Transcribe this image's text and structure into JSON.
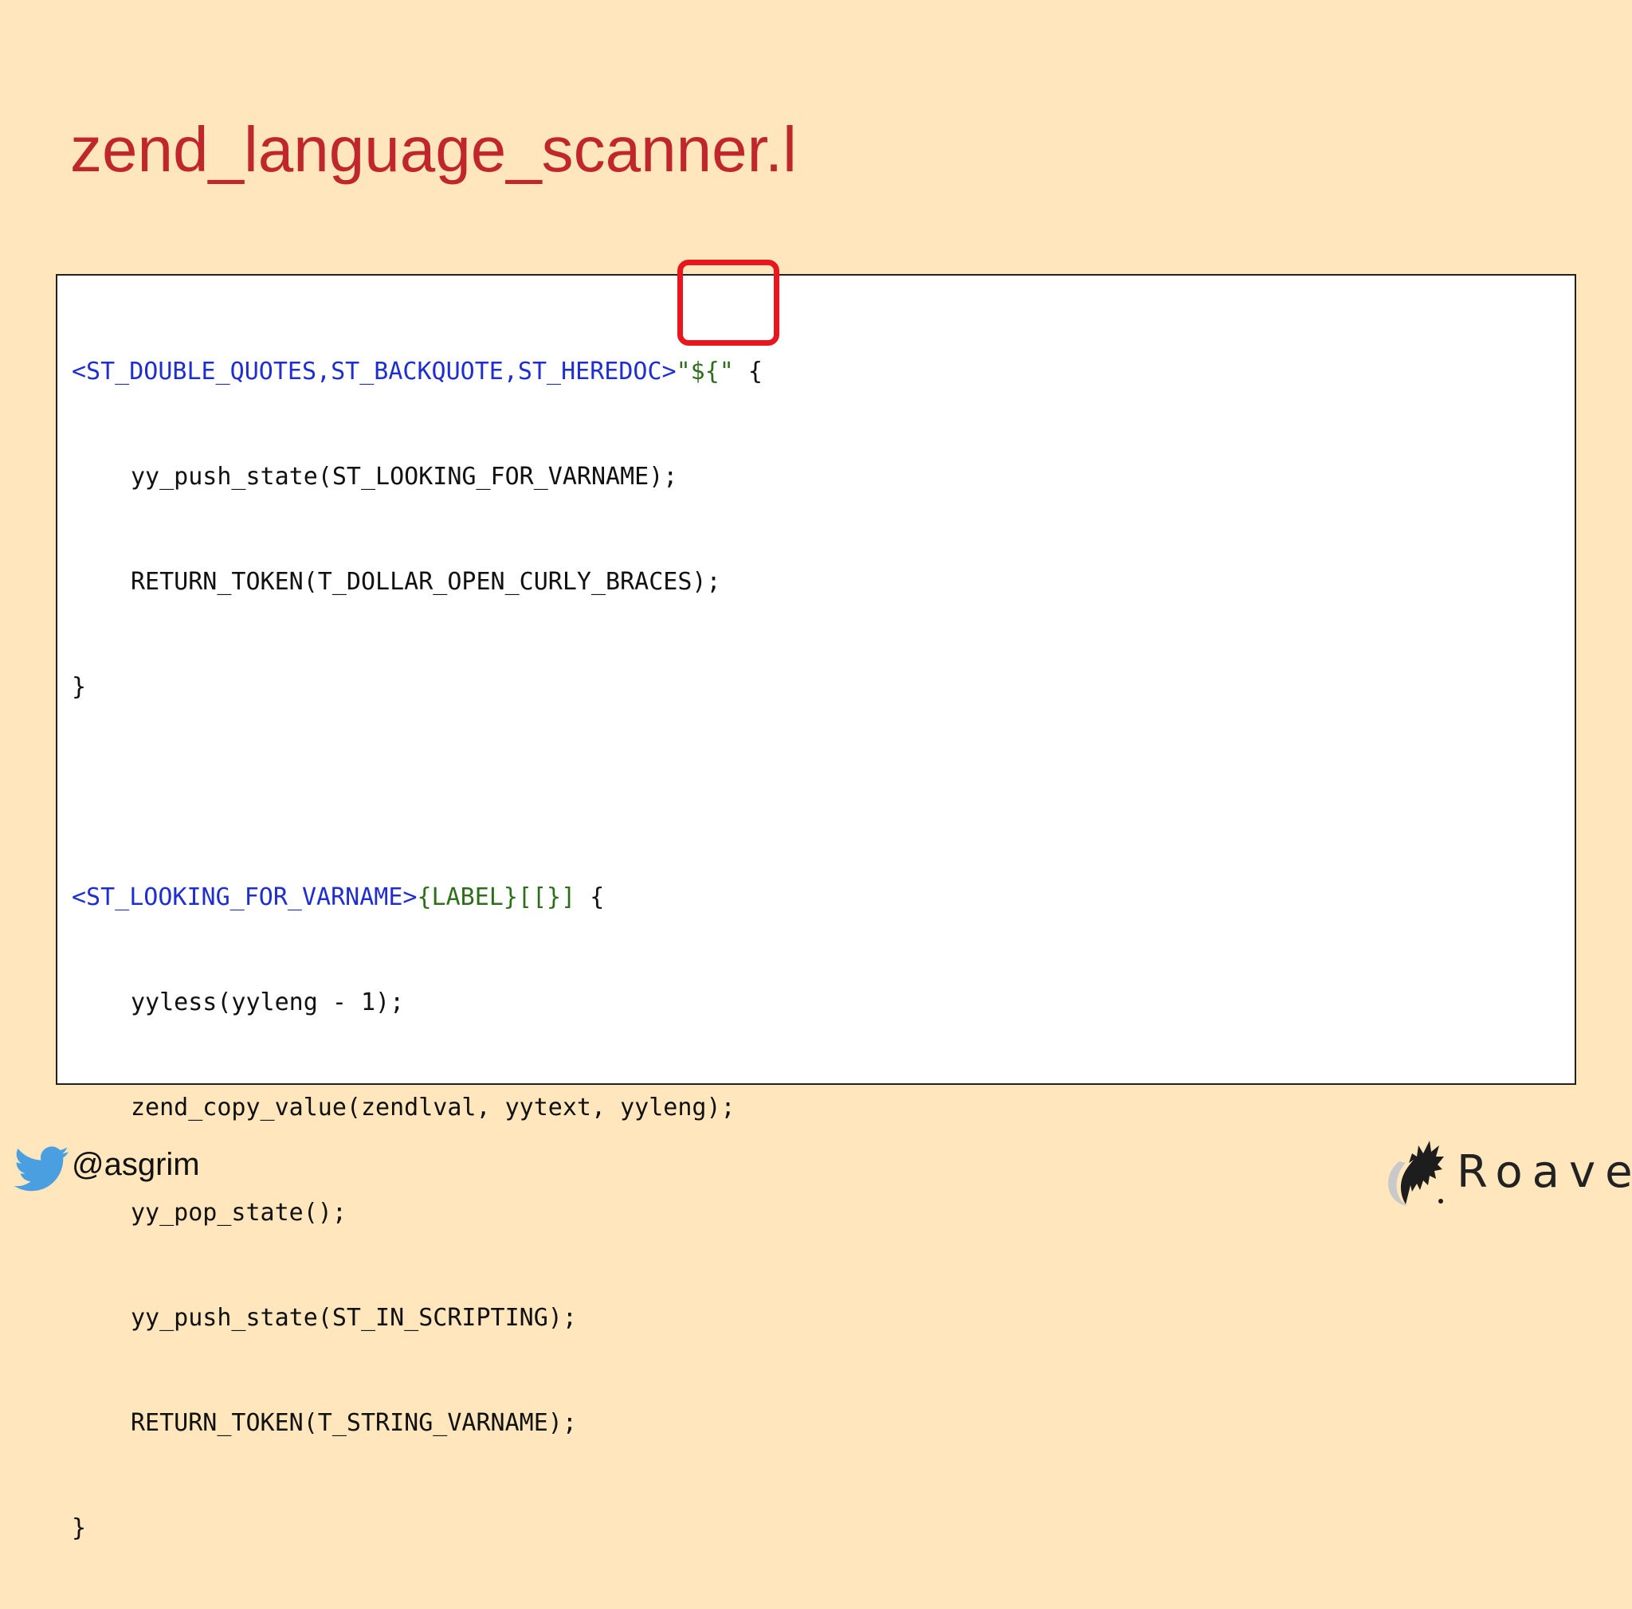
{
  "slide": {
    "title": "zend_language_scanner.l"
  },
  "code": {
    "lines": [
      {
        "state": "<ST_DOUBLE_QUOTES,ST_BACKQUOTE,ST_HEREDOC>",
        "pattern": "\"${\"",
        "tail": " {"
      },
      {
        "text": "yy_push_state(ST_LOOKING_FOR_VARNAME);"
      },
      {
        "text": "RETURN_TOKEN(T_DOLLAR_OPEN_CURLY_BRACES);"
      },
      {
        "text": "}"
      },
      {
        "text": ""
      },
      {
        "state": "<ST_LOOKING_FOR_VARNAME>",
        "pattern": "{LABEL}[[}]",
        "tail": " {"
      },
      {
        "text": "yyless(yyleng - 1);"
      },
      {
        "text": "zend_copy_value(zendlval, yytext, yyleng);"
      },
      {
        "text": "yy_pop_state();"
      },
      {
        "text": "yy_push_state(ST_IN_SCRIPTING);"
      },
      {
        "text": "RETURN_TOKEN(T_STRING_VARNAME);"
      },
      {
        "text": "}"
      }
    ]
  },
  "footer": {
    "twitter_handle": "@asgrim",
    "twitter_icon": "twitter-bird-icon",
    "logo_text": "Roave",
    "logo_icon": "roave-logo-icon"
  },
  "colors": {
    "background": "#ffe6bd",
    "title": "#c0272d",
    "state_token": "#1f2ed1",
    "pattern_token": "#2e6f1b",
    "highlight": "#e8171d",
    "twitter": "#4a9fe0"
  }
}
